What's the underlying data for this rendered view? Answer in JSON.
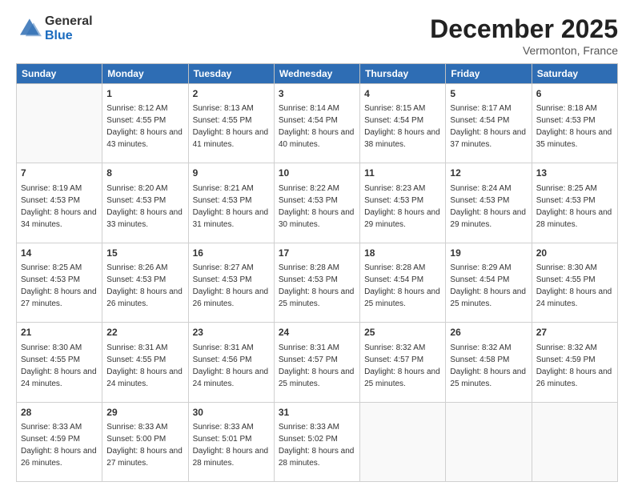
{
  "logo": {
    "general": "General",
    "blue": "Blue"
  },
  "header": {
    "title": "December 2025",
    "subtitle": "Vermonton, France"
  },
  "days_of_week": [
    "Sunday",
    "Monday",
    "Tuesday",
    "Wednesday",
    "Thursday",
    "Friday",
    "Saturday"
  ],
  "weeks": [
    [
      {
        "day": "",
        "sunrise": "",
        "sunset": "",
        "daylight": ""
      },
      {
        "day": "1",
        "sunrise": "Sunrise: 8:12 AM",
        "sunset": "Sunset: 4:55 PM",
        "daylight": "Daylight: 8 hours and 43 minutes."
      },
      {
        "day": "2",
        "sunrise": "Sunrise: 8:13 AM",
        "sunset": "Sunset: 4:55 PM",
        "daylight": "Daylight: 8 hours and 41 minutes."
      },
      {
        "day": "3",
        "sunrise": "Sunrise: 8:14 AM",
        "sunset": "Sunset: 4:54 PM",
        "daylight": "Daylight: 8 hours and 40 minutes."
      },
      {
        "day": "4",
        "sunrise": "Sunrise: 8:15 AM",
        "sunset": "Sunset: 4:54 PM",
        "daylight": "Daylight: 8 hours and 38 minutes."
      },
      {
        "day": "5",
        "sunrise": "Sunrise: 8:17 AM",
        "sunset": "Sunset: 4:54 PM",
        "daylight": "Daylight: 8 hours and 37 minutes."
      },
      {
        "day": "6",
        "sunrise": "Sunrise: 8:18 AM",
        "sunset": "Sunset: 4:53 PM",
        "daylight": "Daylight: 8 hours and 35 minutes."
      }
    ],
    [
      {
        "day": "7",
        "sunrise": "Sunrise: 8:19 AM",
        "sunset": "Sunset: 4:53 PM",
        "daylight": "Daylight: 8 hours and 34 minutes."
      },
      {
        "day": "8",
        "sunrise": "Sunrise: 8:20 AM",
        "sunset": "Sunset: 4:53 PM",
        "daylight": "Daylight: 8 hours and 33 minutes."
      },
      {
        "day": "9",
        "sunrise": "Sunrise: 8:21 AM",
        "sunset": "Sunset: 4:53 PM",
        "daylight": "Daylight: 8 hours and 31 minutes."
      },
      {
        "day": "10",
        "sunrise": "Sunrise: 8:22 AM",
        "sunset": "Sunset: 4:53 PM",
        "daylight": "Daylight: 8 hours and 30 minutes."
      },
      {
        "day": "11",
        "sunrise": "Sunrise: 8:23 AM",
        "sunset": "Sunset: 4:53 PM",
        "daylight": "Daylight: 8 hours and 29 minutes."
      },
      {
        "day": "12",
        "sunrise": "Sunrise: 8:24 AM",
        "sunset": "Sunset: 4:53 PM",
        "daylight": "Daylight: 8 hours and 29 minutes."
      },
      {
        "day": "13",
        "sunrise": "Sunrise: 8:25 AM",
        "sunset": "Sunset: 4:53 PM",
        "daylight": "Daylight: 8 hours and 28 minutes."
      }
    ],
    [
      {
        "day": "14",
        "sunrise": "Sunrise: 8:25 AM",
        "sunset": "Sunset: 4:53 PM",
        "daylight": "Daylight: 8 hours and 27 minutes."
      },
      {
        "day": "15",
        "sunrise": "Sunrise: 8:26 AM",
        "sunset": "Sunset: 4:53 PM",
        "daylight": "Daylight: 8 hours and 26 minutes."
      },
      {
        "day": "16",
        "sunrise": "Sunrise: 8:27 AM",
        "sunset": "Sunset: 4:53 PM",
        "daylight": "Daylight: 8 hours and 26 minutes."
      },
      {
        "day": "17",
        "sunrise": "Sunrise: 8:28 AM",
        "sunset": "Sunset: 4:53 PM",
        "daylight": "Daylight: 8 hours and 25 minutes."
      },
      {
        "day": "18",
        "sunrise": "Sunrise: 8:28 AM",
        "sunset": "Sunset: 4:54 PM",
        "daylight": "Daylight: 8 hours and 25 minutes."
      },
      {
        "day": "19",
        "sunrise": "Sunrise: 8:29 AM",
        "sunset": "Sunset: 4:54 PM",
        "daylight": "Daylight: 8 hours and 25 minutes."
      },
      {
        "day": "20",
        "sunrise": "Sunrise: 8:30 AM",
        "sunset": "Sunset: 4:55 PM",
        "daylight": "Daylight: 8 hours and 24 minutes."
      }
    ],
    [
      {
        "day": "21",
        "sunrise": "Sunrise: 8:30 AM",
        "sunset": "Sunset: 4:55 PM",
        "daylight": "Daylight: 8 hours and 24 minutes."
      },
      {
        "day": "22",
        "sunrise": "Sunrise: 8:31 AM",
        "sunset": "Sunset: 4:55 PM",
        "daylight": "Daylight: 8 hours and 24 minutes."
      },
      {
        "day": "23",
        "sunrise": "Sunrise: 8:31 AM",
        "sunset": "Sunset: 4:56 PM",
        "daylight": "Daylight: 8 hours and 24 minutes."
      },
      {
        "day": "24",
        "sunrise": "Sunrise: 8:31 AM",
        "sunset": "Sunset: 4:57 PM",
        "daylight": "Daylight: 8 hours and 25 minutes."
      },
      {
        "day": "25",
        "sunrise": "Sunrise: 8:32 AM",
        "sunset": "Sunset: 4:57 PM",
        "daylight": "Daylight: 8 hours and 25 minutes."
      },
      {
        "day": "26",
        "sunrise": "Sunrise: 8:32 AM",
        "sunset": "Sunset: 4:58 PM",
        "daylight": "Daylight: 8 hours and 25 minutes."
      },
      {
        "day": "27",
        "sunrise": "Sunrise: 8:32 AM",
        "sunset": "Sunset: 4:59 PM",
        "daylight": "Daylight: 8 hours and 26 minutes."
      }
    ],
    [
      {
        "day": "28",
        "sunrise": "Sunrise: 8:33 AM",
        "sunset": "Sunset: 4:59 PM",
        "daylight": "Daylight: 8 hours and 26 minutes."
      },
      {
        "day": "29",
        "sunrise": "Sunrise: 8:33 AM",
        "sunset": "Sunset: 5:00 PM",
        "daylight": "Daylight: 8 hours and 27 minutes."
      },
      {
        "day": "30",
        "sunrise": "Sunrise: 8:33 AM",
        "sunset": "Sunset: 5:01 PM",
        "daylight": "Daylight: 8 hours and 28 minutes."
      },
      {
        "day": "31",
        "sunrise": "Sunrise: 8:33 AM",
        "sunset": "Sunset: 5:02 PM",
        "daylight": "Daylight: 8 hours and 28 minutes."
      },
      {
        "day": "",
        "sunrise": "",
        "sunset": "",
        "daylight": ""
      },
      {
        "day": "",
        "sunrise": "",
        "sunset": "",
        "daylight": ""
      },
      {
        "day": "",
        "sunrise": "",
        "sunset": "",
        "daylight": ""
      }
    ]
  ]
}
